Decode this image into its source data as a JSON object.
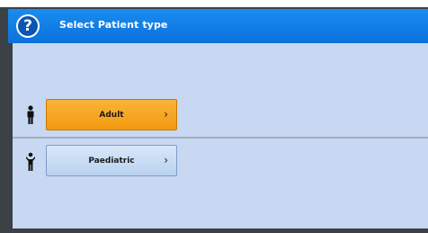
{
  "dialog": {
    "title": "Select Patient type",
    "help_icon_glyph": "?",
    "help_icon": "question-circle-icon"
  },
  "options": [
    {
      "label": "Adult",
      "icon": "adult-person-icon",
      "chevron": "›",
      "state": "selected"
    },
    {
      "label": "Paediatric",
      "icon": "child-person-icon",
      "chevron": "›",
      "state": "normal"
    }
  ],
  "colors": {
    "title_bar": "#0a71dc",
    "panel_bg": "#c8d8f3",
    "selected_button": "#f29a10",
    "normal_button": "#c9ddf5"
  }
}
